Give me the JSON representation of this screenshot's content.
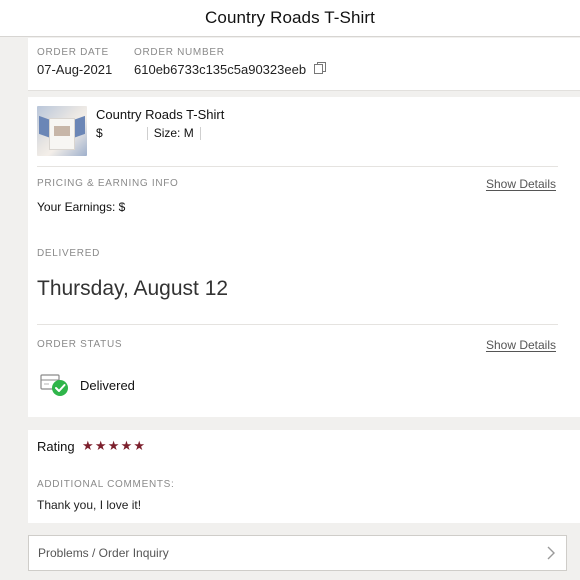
{
  "header": {
    "title": "Country Roads T-Shirt"
  },
  "order": {
    "date_label": "ORDER DATE",
    "date_value": "07-Aug-2021",
    "number_label": "ORDER NUMBER",
    "number_value": "610eb6733c135c5a90323eeb"
  },
  "product": {
    "name": "Country Roads T-Shirt",
    "price": "$",
    "size": "Size: M"
  },
  "pricing": {
    "label": "PRICING & EARNING INFO",
    "link": "Show Details",
    "earnings": "Your Earnings: $"
  },
  "delivery": {
    "label": "DELIVERED",
    "date": "Thursday, August 12"
  },
  "status": {
    "label": "ORDER STATUS",
    "link": "Show Details",
    "value": "Delivered",
    "icon": "package-check-icon"
  },
  "rating": {
    "label": "Rating",
    "stars": "★★★★★",
    "stars_value": 5,
    "comments_label": "ADDITIONAL COMMENTS:",
    "comment": "Thank you, I love it!"
  },
  "problems": {
    "label": "Problems / Order Inquiry"
  },
  "colors": {
    "accent_star": "#7c1f2c",
    "status_green": "#2fb54a"
  }
}
